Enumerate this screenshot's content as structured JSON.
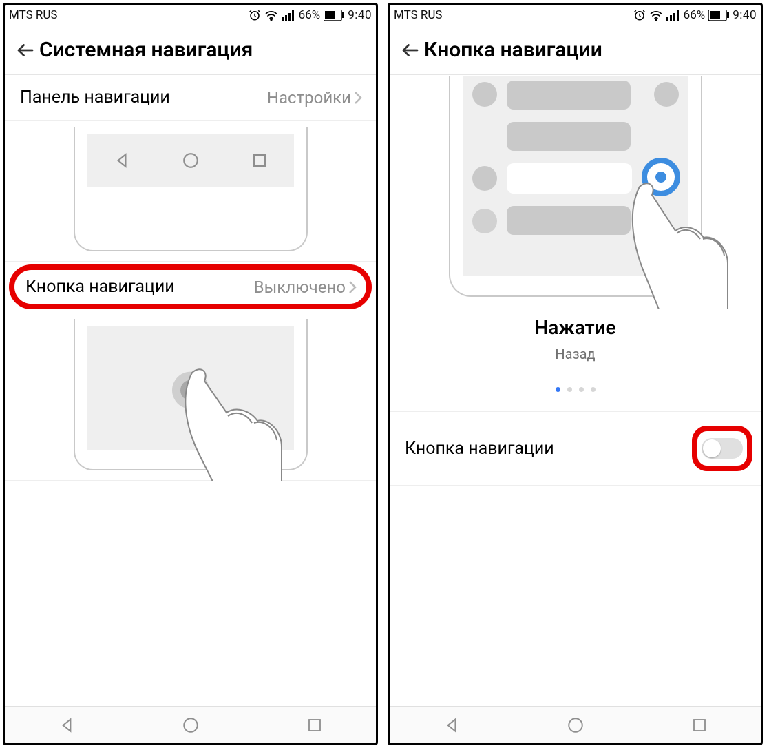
{
  "status": {
    "carrier": "MTS RUS",
    "battery_pct": "66%",
    "time": "9:40"
  },
  "screen1": {
    "title": "Системная навигация",
    "row1": {
      "label": "Панель навигации",
      "value": "Настройки"
    },
    "row2": {
      "label": "Кнопка навигации",
      "value": "Выключено"
    }
  },
  "screen2": {
    "title": "Кнопка навигации",
    "caption_title": "Нажатие",
    "caption_sub": "Назад",
    "toggle_label": "Кнопка навигации"
  }
}
